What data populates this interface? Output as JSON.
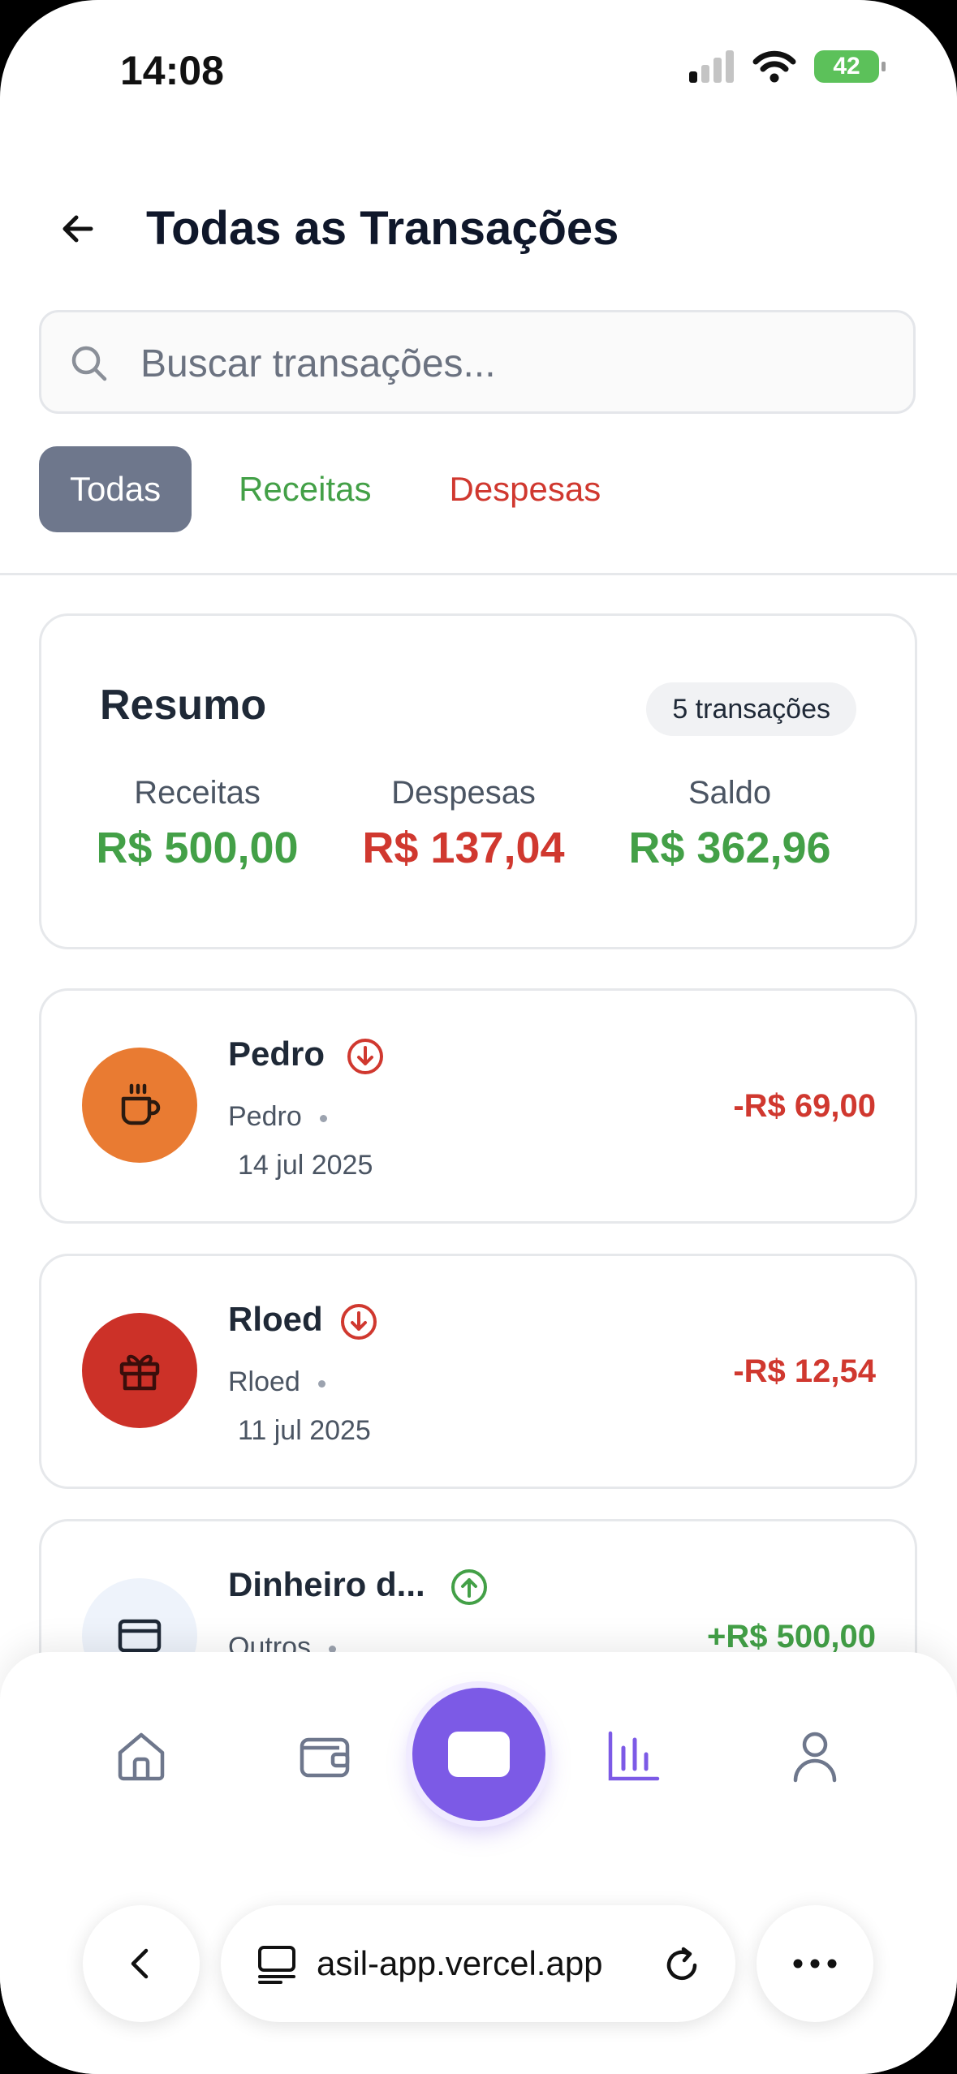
{
  "status_bar": {
    "time": "14:08",
    "battery": "42"
  },
  "header": {
    "title": "Todas as Transações"
  },
  "search": {
    "placeholder": "Buscar transações..."
  },
  "filters": [
    {
      "label": "Todas",
      "active": true
    },
    {
      "label": "Receitas",
      "active": false
    },
    {
      "label": "Despesas",
      "active": false
    }
  ],
  "summary": {
    "title": "Resumo",
    "count": "5 transações",
    "income_label": "Receitas",
    "income_value": "R$ 500,00",
    "expense_label": "Despesas",
    "expense_value": "R$ 137,04",
    "balance_label": "Saldo",
    "balance_value": "R$ 362,96"
  },
  "transactions": [
    {
      "name": "Pedro",
      "category": "Pedro",
      "date": "14 jul 2025",
      "amount": "-R$ 69,00",
      "type": "expense",
      "icon": "coffee-icon",
      "color": "#e97b32"
    },
    {
      "name": "Rloed",
      "category": "Rloed",
      "date": "11 jul 2025",
      "amount": "-R$ 12,54",
      "type": "expense",
      "icon": "gift-icon",
      "color": "#cc3128"
    },
    {
      "name": "Dinheiro d...",
      "category": "Outros",
      "date": "",
      "amount": "+R$ 500,00",
      "type": "income",
      "icon": "card-icon",
      "color": "#eef3fb"
    }
  ],
  "nav": {
    "items": [
      "home-icon",
      "wallet-icon",
      "add-icon",
      "chart-icon",
      "user-icon"
    ],
    "active": "chart-icon"
  },
  "browser": {
    "url": "asil-app.vercel.app"
  }
}
